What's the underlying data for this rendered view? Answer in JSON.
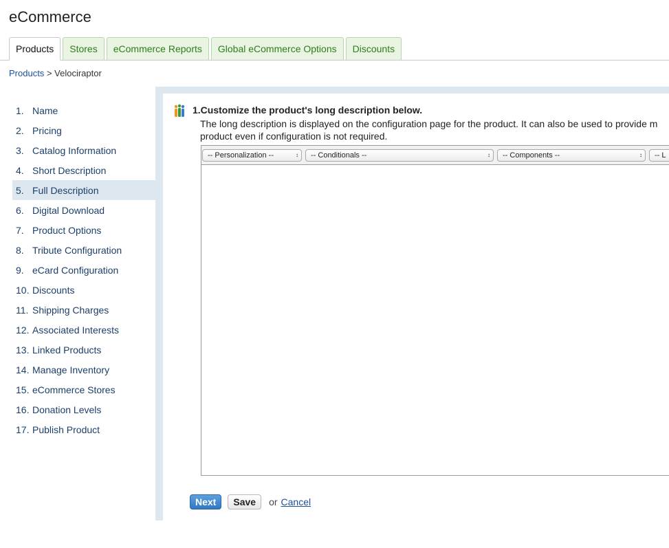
{
  "app_title": "eCommerce",
  "tabs": [
    {
      "label": "Products",
      "active": true
    },
    {
      "label": "Stores",
      "active": false
    },
    {
      "label": "eCommerce Reports",
      "active": false
    },
    {
      "label": "Global eCommerce Options",
      "active": false
    },
    {
      "label": "Discounts",
      "active": false
    }
  ],
  "breadcrumb": {
    "link": "Products",
    "separator": ">",
    "current": "Velociraptor"
  },
  "sidebar": {
    "items": [
      {
        "num": "1.",
        "label": "Name"
      },
      {
        "num": "2.",
        "label": "Pricing"
      },
      {
        "num": "3.",
        "label": "Catalog Information"
      },
      {
        "num": "4.",
        "label": "Short Description"
      },
      {
        "num": "5.",
        "label": "Full Description",
        "active": true
      },
      {
        "num": "6.",
        "label": "Digital Download"
      },
      {
        "num": "7.",
        "label": "Product Options"
      },
      {
        "num": "8.",
        "label": "Tribute Configuration"
      },
      {
        "num": "9.",
        "label": "eCard Configuration"
      },
      {
        "num": "10.",
        "label": "Discounts"
      },
      {
        "num": "11.",
        "label": "Shipping Charges"
      },
      {
        "num": "12.",
        "label": "Associated Interests"
      },
      {
        "num": "13.",
        "label": "Linked Products"
      },
      {
        "num": "14.",
        "label": "Manage Inventory"
      },
      {
        "num": "15.",
        "label": "eCommerce Stores"
      },
      {
        "num": "16.",
        "label": "Donation Levels"
      },
      {
        "num": "17.",
        "label": "Publish Product"
      }
    ]
  },
  "main": {
    "heading": "1.Customize the product's long description below.",
    "description_line1": "The long description is displayed on the configuration page for the product. It can also be used to provide m",
    "description_line2": "product even if configuration is not required.",
    "toolbar": {
      "personalization": "-- Personalization --",
      "conditionals": "-- Conditionals --",
      "components": "-- Components --",
      "more": "-- L"
    }
  },
  "actions": {
    "next_label": "Next",
    "save_label": "Save",
    "or_text": "or",
    "cancel_label": "Cancel"
  },
  "colors": {
    "accent_blue": "#2f78c4",
    "tab_green_bg": "#e9f4e2",
    "tab_green_text": "#2e7d1b",
    "sidebar_active_bg": "#dde7ef"
  },
  "icons": {
    "step_icon": "people-icon",
    "select_arrows": "up-down-arrows-icon"
  }
}
